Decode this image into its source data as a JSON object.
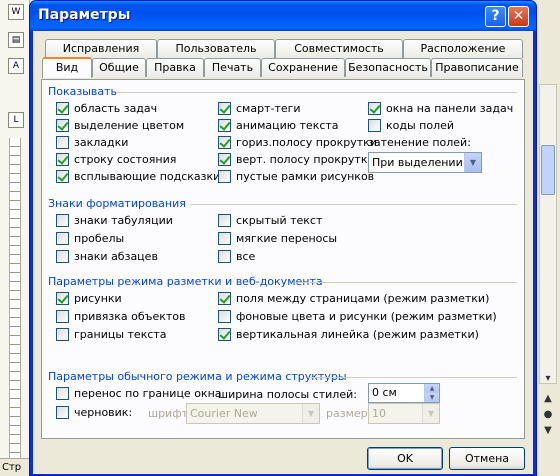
{
  "window_title": "Параметры",
  "titlebar_buttons": {
    "help": "?",
    "close": "✕"
  },
  "tabs_row1": [
    "Исправления",
    "Пользователь",
    "Совместимость",
    "Расположение"
  ],
  "tabs_row2": [
    "Вид",
    "Общие",
    "Правка",
    "Печать",
    "Сохранение",
    "Безопасность",
    "Правописание"
  ],
  "active_tab": "Вид",
  "show": {
    "title": "Показывать",
    "col1": [
      {
        "label": "область задач",
        "checked": true
      },
      {
        "label": "выделение цветом",
        "checked": true
      },
      {
        "label": "закладки",
        "checked": false
      },
      {
        "label": "строку состояния",
        "checked": true
      },
      {
        "label": "всплывающие подсказки",
        "checked": true
      }
    ],
    "col2": [
      {
        "label": "смарт-теги",
        "checked": true
      },
      {
        "label": "анимацию текста",
        "checked": true
      },
      {
        "label": "гориз.полосу прокрутки",
        "checked": true
      },
      {
        "label": "верт. полосу прокрутки",
        "checked": true
      },
      {
        "label": "пустые рамки рисунков",
        "checked": false
      }
    ],
    "col3": [
      {
        "label": "окна на панели задач",
        "checked": true
      },
      {
        "label": "коды полей",
        "checked": false
      }
    ],
    "shading_label": "затенение полей:",
    "shading_value": "При выделении"
  },
  "formatting": {
    "title": "Знаки форматирования",
    "col1": [
      {
        "label": "знаки табуляции",
        "checked": false
      },
      {
        "label": "пробелы",
        "checked": false
      },
      {
        "label": "знаки абзацев",
        "checked": false
      }
    ],
    "col2": [
      {
        "label": "скрытый текст",
        "checked": false
      },
      {
        "label": "мягкие переносы",
        "checked": false
      },
      {
        "label": "все",
        "checked": false
      }
    ]
  },
  "layout": {
    "title": "Параметры режима разметки и веб-документа",
    "col1": [
      {
        "label": "рисунки",
        "checked": true
      },
      {
        "label": "привязка объектов",
        "checked": false
      },
      {
        "label": "границы текста",
        "checked": false
      }
    ],
    "col2": [
      {
        "label": "поля между страницами (режим разметки)",
        "checked": true
      },
      {
        "label": "фоновые цвета и рисунки (режим разметки)",
        "checked": false
      },
      {
        "label": "вертикальная линейка (режим разметки)",
        "checked": true
      }
    ]
  },
  "normal": {
    "title": "Параметры обычного режима и режима структуры",
    "wrap": {
      "label": "перенос по границе окна",
      "checked": false
    },
    "draft": {
      "label": "черновик:",
      "checked": false
    },
    "style_width_label": "ширина полосы стилей:",
    "style_width_value": "0 см",
    "font_label": "шрифт:",
    "font_value": "Courier New",
    "size_label": "размер:",
    "size_value": "10"
  },
  "buttons": {
    "ok": "OK",
    "cancel": "Отмена"
  },
  "background": {
    "status_text": "Стр",
    "ruler_icon": "L",
    "nav_up": "▲",
    "nav_dot": "●",
    "nav_down": "▼"
  }
}
